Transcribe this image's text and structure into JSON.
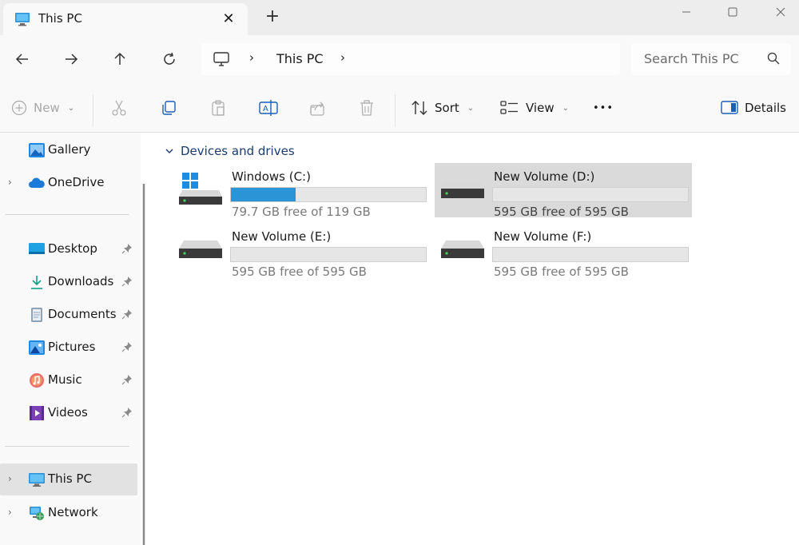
{
  "tab": {
    "title": "This PC",
    "close_glyph": "✕",
    "newtab_glyph": "+"
  },
  "window": {
    "minimize_glyph": "—",
    "close_glyph": "✕"
  },
  "nav": {
    "back_glyph": "←",
    "forward_glyph": "→",
    "up_glyph": "↑",
    "refresh_glyph": "↻",
    "address_chevron": "›",
    "address_text": "This PC",
    "search_placeholder": "Search This PC"
  },
  "commands": {
    "new_label": "New",
    "sort_label": "Sort",
    "view_label": "View",
    "more_glyph": "•••",
    "details_label": "Details",
    "caret_glyph": "⌄"
  },
  "sidebar": {
    "chevron_glyph": "›",
    "items": [
      {
        "label": "Gallery",
        "icon": "gallery-icon"
      },
      {
        "label": "OneDrive",
        "icon": "cloud-icon"
      },
      {
        "label": "Desktop",
        "icon": "desktop-icon",
        "pinned": true
      },
      {
        "label": "Downloads",
        "icon": "download-icon",
        "pinned": true
      },
      {
        "label": "Documents",
        "icon": "document-icon",
        "pinned": true
      },
      {
        "label": "Pictures",
        "icon": "pictures-icon",
        "pinned": true
      },
      {
        "label": "Music",
        "icon": "music-icon",
        "pinned": true
      },
      {
        "label": "Videos",
        "icon": "video-icon",
        "pinned": true
      },
      {
        "label": "This PC",
        "icon": "computer-icon",
        "selected": true
      },
      {
        "label": "Network",
        "icon": "network-icon"
      }
    ]
  },
  "main": {
    "group_chevron": "⌄",
    "group_title": "Devices and drives",
    "drives": [
      {
        "name": "Windows (C:)",
        "free_text": "79.7 GB free of 119 GB",
        "used_fraction": 0.33,
        "system": true,
        "selected": false
      },
      {
        "name": "New Volume (D:)",
        "free_text": "595 GB free of 595 GB",
        "used_fraction": 0.0,
        "system": false,
        "selected": true
      },
      {
        "name": "New Volume (E:)",
        "free_text": "595 GB free of 595 GB",
        "used_fraction": 0.0,
        "system": false,
        "selected": false
      },
      {
        "name": "New Volume (F:)",
        "free_text": "595 GB free of 595 GB",
        "used_fraction": 0.0,
        "system": false,
        "selected": false
      }
    ]
  },
  "colors": {
    "accent": "#2a94d6",
    "selected_bg": "#dadada",
    "group_header": "#1c3a6e"
  }
}
